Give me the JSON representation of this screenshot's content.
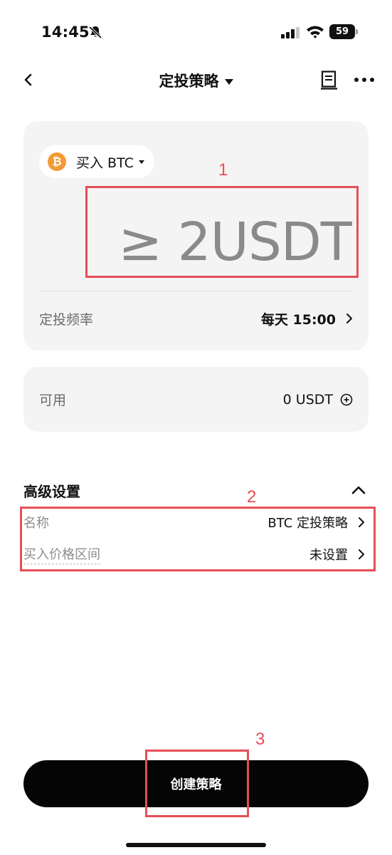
{
  "status_bar": {
    "time": "14:45",
    "battery": "59"
  },
  "nav": {
    "title": "定投策略"
  },
  "asset": {
    "label": "买入 BTC",
    "icon_glyph": "₿"
  },
  "amount": {
    "placeholder": "≥ 2USDT"
  },
  "frequency": {
    "label": "定投频率",
    "value": "每天 15:00"
  },
  "available": {
    "label": "可用",
    "value": "0 USDT"
  },
  "advanced": {
    "title": "高级设置",
    "rows": [
      {
        "label": "名称",
        "value": "BTC 定投策略"
      },
      {
        "label": "买入价格区间",
        "value": "未设置"
      }
    ]
  },
  "create_button": {
    "label": "创建策略"
  },
  "annotations": {
    "one": "1",
    "two": "2",
    "three": "3"
  },
  "colors": {
    "accent_red": "#e54f56",
    "btc_orange": "#f29a35",
    "button_black": "#050505",
    "card_gray": "#f4f4f4"
  }
}
